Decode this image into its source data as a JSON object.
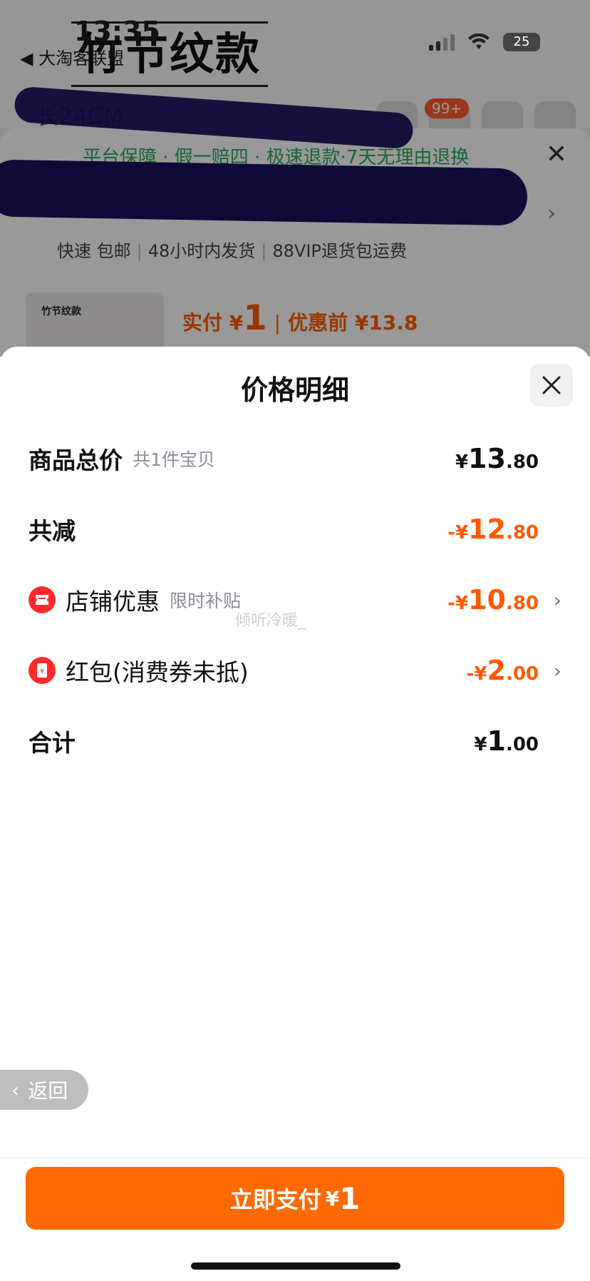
{
  "status_bar": {
    "time": "13:35",
    "back_app": "◀ 大淘客联盟",
    "battery": "25"
  },
  "background_page": {
    "hero_title": "竹节纹款",
    "size_text": "长24CM",
    "cart_badge": "99+",
    "guarantee_text": "平台保障 · 假一赔四 · 极速退款·7天无理由退换",
    "shipping": [
      "快速 包邮",
      "48小时内发货",
      "88VIP退货包运费"
    ],
    "thumb_text": "竹节纹款",
    "price_prefix": "实付 ¥",
    "price_amount": "1",
    "price_before": "优惠前 ¥13.8"
  },
  "sheet": {
    "title": "价格明细",
    "watermark": "倾听冷暖_",
    "rows": [
      {
        "label": "商品总价",
        "sub": "共1件宝贝",
        "currency": "¥",
        "int": "13",
        "dec": ".80",
        "color": "#111111"
      },
      {
        "label": "共减",
        "sub": "",
        "currency": "-¥",
        "int": "12",
        "dec": ".80",
        "color": "#ff5a00"
      },
      {
        "label": "店铺优惠",
        "sub": "限时补贴",
        "currency": "-¥",
        "int": "10",
        "dec": ".80",
        "color": "#ff5a00",
        "icon": "store-coupon-icon"
      },
      {
        "label": "红包(消费券未抵)",
        "sub": "",
        "currency": "-¥",
        "int": "2",
        "dec": ".00",
        "color": "#ff5a00",
        "icon": "red-packet-icon"
      },
      {
        "label": "合计",
        "sub": "",
        "currency": "¥",
        "int": "1",
        "dec": ".00",
        "color": "#111111"
      }
    ]
  },
  "back_button": {
    "label": "返回"
  },
  "pay_button": {
    "label": "立即支付",
    "currency": "¥",
    "amount": "1"
  },
  "colors": {
    "accent": "#ff6a00",
    "discount": "#ff5a00"
  }
}
